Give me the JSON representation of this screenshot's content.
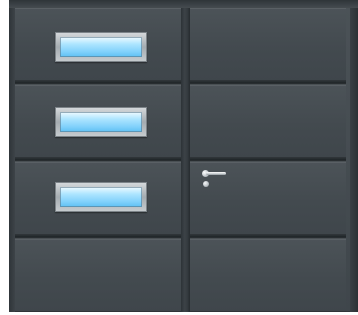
{
  "scene": {
    "subject": "garage-side-hinged-door",
    "colors": {
      "door_anthracite": "#41484d",
      "frame": "#4b5257",
      "groove_dark": "#1e2326",
      "glass_light": "#aee5ff",
      "glass_deep": "#5ec0f3",
      "handle_metal": "#cfd4d8"
    },
    "left_leaf": {
      "panel_count": 4,
      "window_count": 3
    },
    "right_leaf": {
      "panel_count": 4,
      "window_count": 0
    }
  }
}
